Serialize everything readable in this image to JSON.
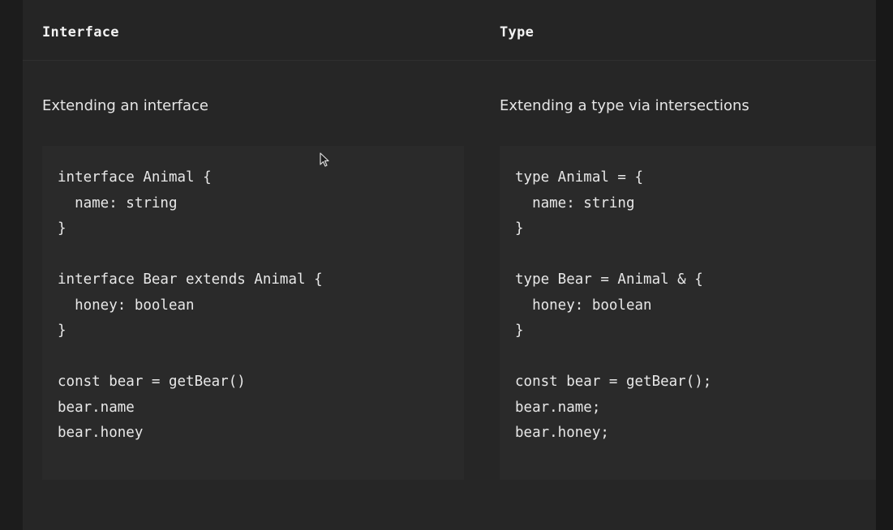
{
  "columns": [
    {
      "header": "Interface",
      "subtitle": "Extending an interface",
      "code": [
        "interface Animal {",
        "  name: string",
        "}",
        "",
        "interface Bear extends Animal {",
        "  honey: boolean",
        "}",
        "",
        "const bear = getBear()",
        "bear.name",
        "bear.honey"
      ]
    },
    {
      "header": "Type",
      "subtitle": "Extending a type via intersections",
      "code": [
        "type Animal = {",
        "  name: string",
        "}",
        "",
        "type Bear = Animal & {",
        "  honey: boolean",
        "}",
        "",
        "const bear = getBear();",
        "bear.name;",
        "bear.honey;"
      ]
    }
  ],
  "icons": {
    "cursor": "mouse-pointer-icon"
  },
  "colors": {
    "background": "#1c1c1c",
    "panel": "#262626",
    "code_box": "#2a2a2a",
    "text": "#e8e8e8"
  }
}
